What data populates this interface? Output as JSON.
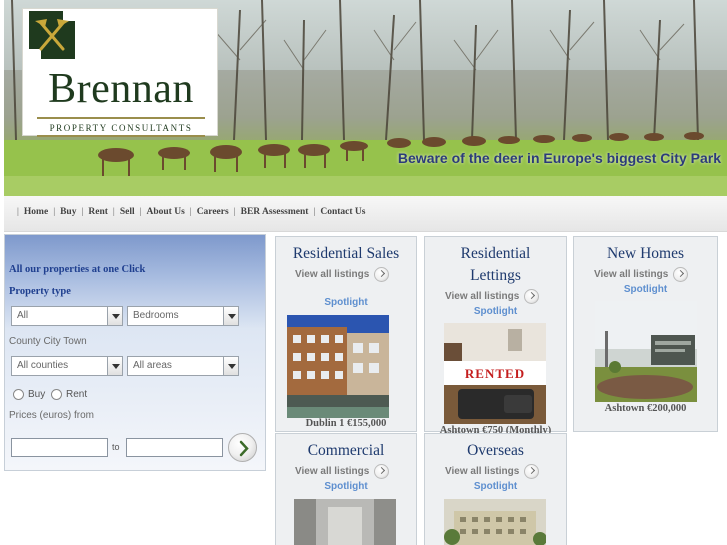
{
  "brand": {
    "name": "Brennan",
    "subtitle": "PROPERTY CONSULTANTS",
    "tagline": "Beware of the deer in Europe's biggest City Park",
    "colors": {
      "brand_green": "#1f3a1e",
      "tagline_blue": "#2b3b7a",
      "link_blue": "#1e3a6e",
      "spotlight_blue": "#5e8fcf"
    }
  },
  "nav": {
    "items": [
      "Home",
      "Buy",
      "Rent",
      "Sell",
      "About Us",
      "Careers",
      "BER Assessment",
      "Contact Us"
    ]
  },
  "search": {
    "heading": "All our properties at one Click",
    "property_type_label": "Property type",
    "type_select": "All",
    "bedrooms_select": "Bedrooms",
    "location_label": "County City Town",
    "counties_select": "All counties",
    "areas_select": "All areas",
    "radio_buy": "Buy",
    "radio_rent": "Rent",
    "price_label": "Prices (euros) from",
    "price_from": "",
    "price_to": "",
    "to_label": "to",
    "go_icon": "chevron-right-icon"
  },
  "cards": {
    "residential_sales": {
      "title": "Residential Sales",
      "view_all": "View all listings",
      "spotlight": "Spotlight",
      "caption": "Dublin 1 €155,000"
    },
    "residential_lettings": {
      "title_line1": "Residential",
      "title_line2": "Lettings",
      "view_all": "View all listings",
      "spotlight": "Spotlight",
      "rented_stamp": "RENTED",
      "caption": "Ashtown €750 (Monthly)"
    },
    "new_homes": {
      "title": "New Homes",
      "view_all": "View all listings",
      "spotlight": "Spotlight",
      "caption": "Ashtown €200,000"
    },
    "commercial": {
      "title": "Commercial",
      "view_all": "View all listings",
      "spotlight": "Spotlight"
    },
    "overseas": {
      "title": "Overseas",
      "view_all": "View all listings",
      "spotlight": "Spotlight"
    }
  }
}
